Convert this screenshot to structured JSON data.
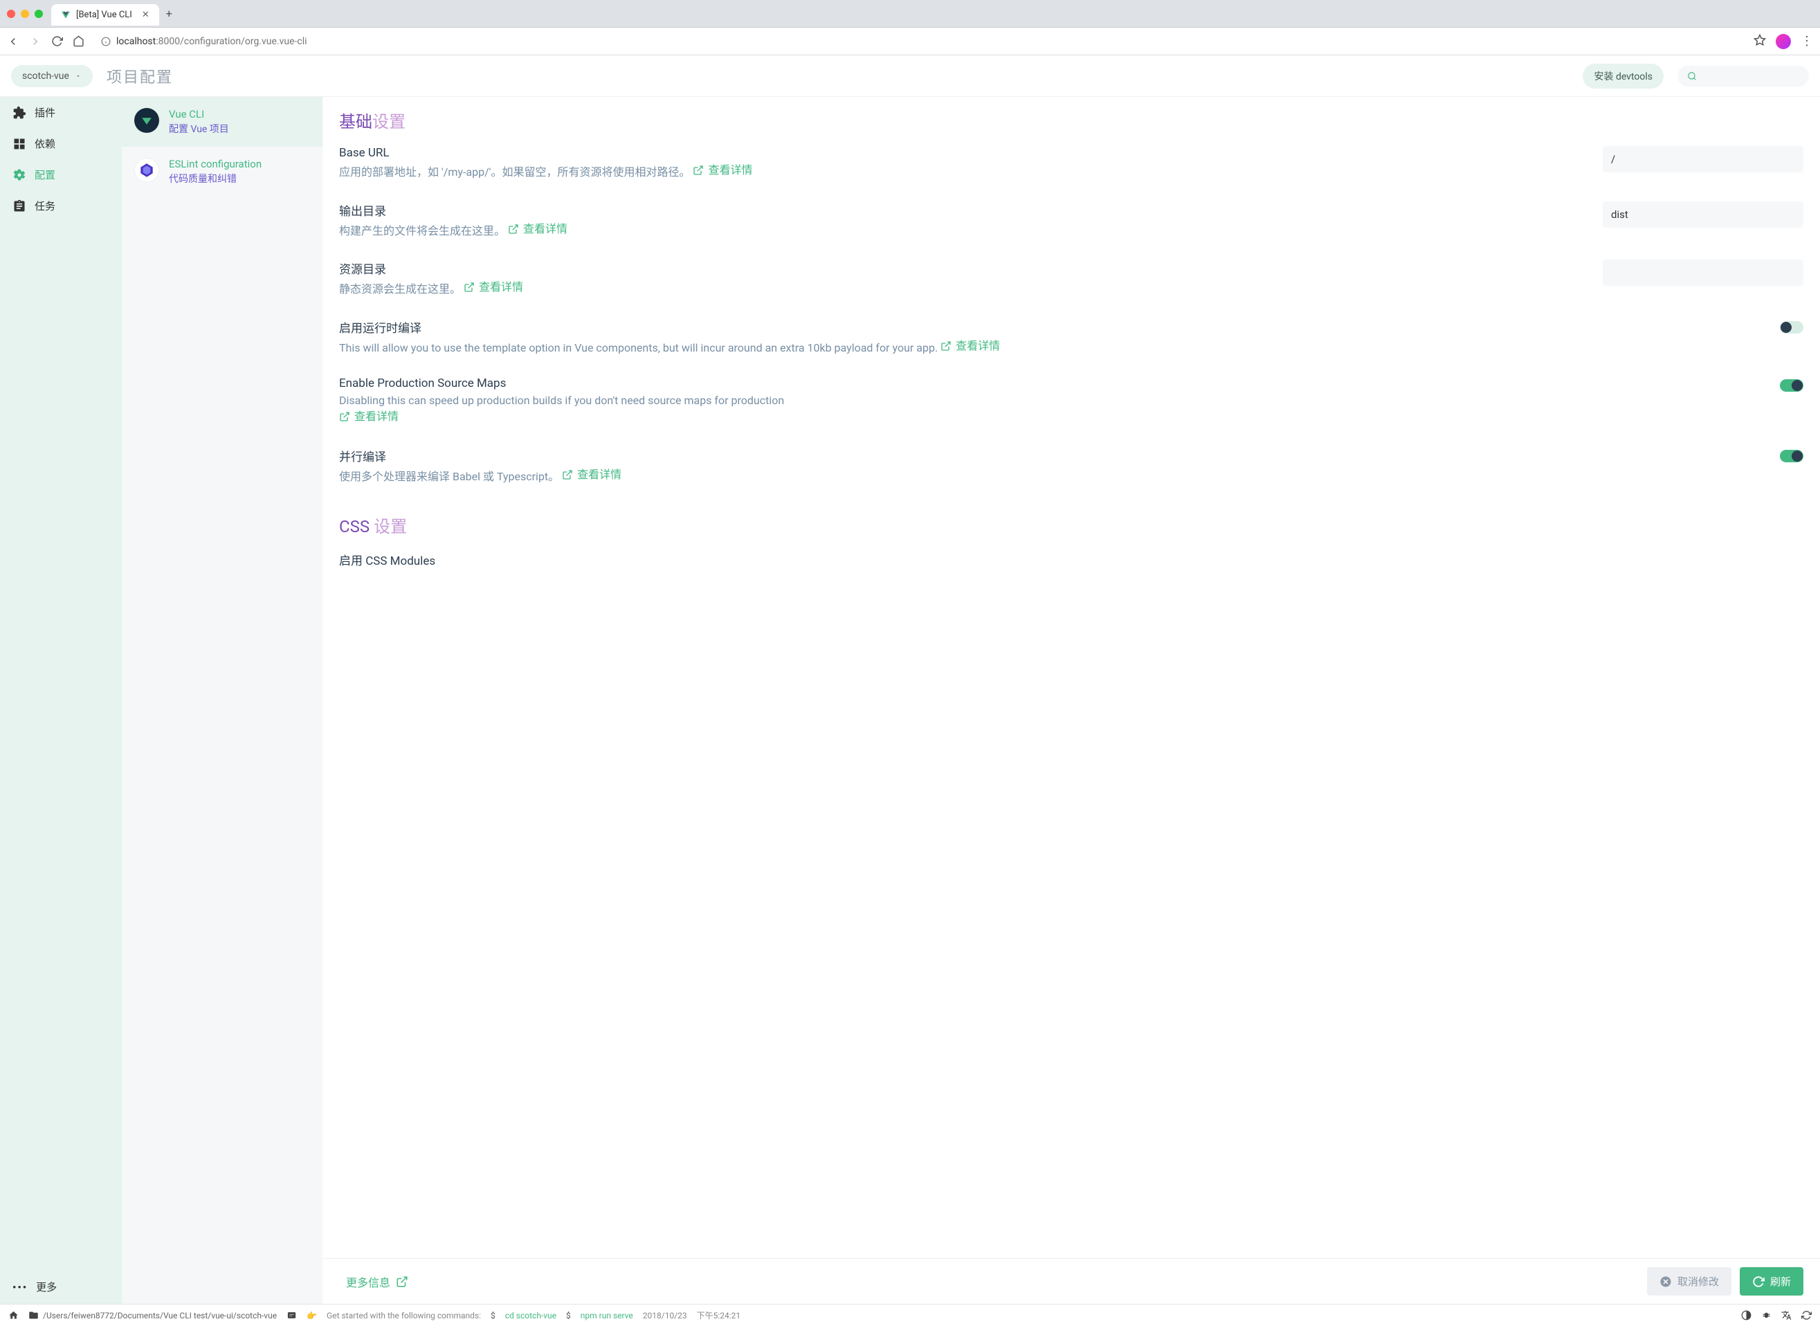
{
  "browser": {
    "tab_title": "[Beta] Vue CLI",
    "url_host": "localhost",
    "url_port": ":8000",
    "url_path": "/configuration/org.vue.vue-cli"
  },
  "header": {
    "project_name": "scotch-vue",
    "page_title": "项目配置",
    "devtools_btn": "安装 devtools"
  },
  "sidebar": {
    "items": [
      {
        "label": "插件"
      },
      {
        "label": "依赖"
      },
      {
        "label": "配置"
      },
      {
        "label": "任务"
      }
    ],
    "more": "更多"
  },
  "config_list": [
    {
      "title": "Vue CLI",
      "desc": "配置 Vue 项目"
    },
    {
      "title": "ESLint configuration",
      "desc": "代码质量和纠错"
    }
  ],
  "settings": {
    "section1_h1": "基础",
    "section1_h2": "设置",
    "link_more_text": "查看详情",
    "rows": [
      {
        "label": "Base URL",
        "desc": "应用的部署地址，如 '/my-app/'。如果留空，所有资源将使用相对路径。",
        "value": "/"
      },
      {
        "label": "输出目录",
        "desc": "构建产生的文件将会生成在这里。",
        "value": "dist"
      },
      {
        "label": "资源目录",
        "desc": "静态资源会生成在这里。",
        "value": ""
      },
      {
        "label": "启用运行时编译",
        "desc": "This will allow you to use the template option in Vue components, but will incur around an extra 10kb payload for your app."
      },
      {
        "label": "Enable Production Source Maps",
        "desc": "Disabling this can speed up production builds if you don't need source maps for production"
      },
      {
        "label": "并行编译",
        "desc": "使用多个处理器来编译 Babel 或 Typescript。"
      }
    ],
    "section2_h1": "CSS",
    "section2_h2": " 设置",
    "css_row_label": "启用 CSS Modules"
  },
  "action_bar": {
    "more_info": "更多信息",
    "cancel": "取消修改",
    "refresh": "刷新"
  },
  "status": {
    "project_path": "/Users/feiwen8772/Documents/Vue CLI test/vue-ui/scotch-vue",
    "msg_prefix": "Get started with the following commands:",
    "cmd1": "cd scotch-vue",
    "cmd2": "npm run serve",
    "date": "2018/10/23",
    "time": "下午5:24:21"
  }
}
